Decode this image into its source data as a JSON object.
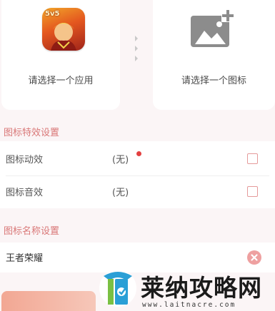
{
  "pickers": {
    "app_label": "请选择一个应用",
    "icon_label": "请选择一个图标",
    "app_badge": "5v5"
  },
  "effects": {
    "title": "图标特效设置",
    "rows": [
      {
        "label": "图标动效",
        "value": "(无)",
        "checked": false,
        "has_dot": true
      },
      {
        "label": "图标音效",
        "value": "(无)",
        "checked": false,
        "has_dot": false
      }
    ]
  },
  "name_settings": {
    "title": "图标名称设置",
    "value": "王者荣耀"
  },
  "watermark": {
    "title": "莱纳攻略网",
    "url": "www.laitnacre.com"
  },
  "colors": {
    "accent": "#d97777",
    "checkbox_border": "#e59a9a",
    "clear_button": "#eea0a0",
    "notify_dot": "#e34040",
    "background": "#fbf5f6"
  },
  "icons": {
    "app": "app-game-icon",
    "placeholder": "add-image-icon",
    "clear": "clear-icon",
    "arrows": "chevron-right-icon"
  }
}
